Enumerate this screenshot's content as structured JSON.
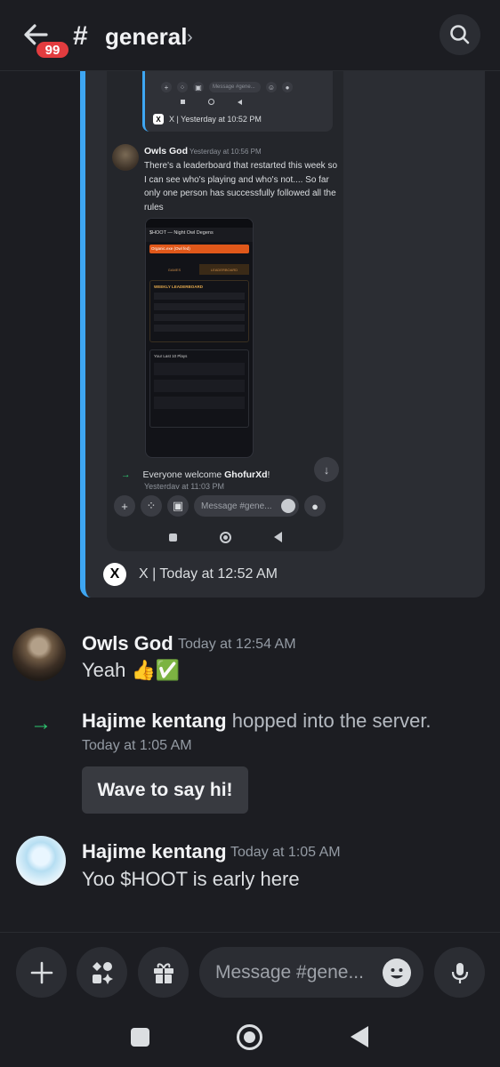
{
  "header": {
    "unread_count": "99",
    "hash": "#",
    "channel_name": "general",
    "chevron": "›"
  },
  "embed": {
    "phone": {
      "input_placeholder": "Message #gene...",
      "prev_embed_source": "X | Yesterday at 10:52 PM",
      "author": "Owls God",
      "time": "Yesterday at 10:56 PM",
      "text": "There's a leaderboard that restarted this week so I can see who's playing and who's not.... So far only one person has successfully followed all the rules",
      "shot": {
        "title": "$HOOT — Night Owl Degens",
        "banner": "Organic.exe (Owl fed)",
        "tab_left": "GAMES",
        "tab_right": "LEADERBOARD",
        "leaderboard_title": "WEEKLY LEADERBOARD",
        "plays_title": "Your Last 10 Plays"
      },
      "welcome_prefix": "Everyone welcome ",
      "welcome_name": "GhofurXd",
      "welcome_suffix": "!",
      "welcome_time": "Yesterday at 11:03 PM",
      "chat_input_placeholder": "Message #gene..."
    },
    "footer": "X | Today at 12:52 AM"
  },
  "messages": [
    {
      "author": "Owls God",
      "time": "Today at 12:54 AM",
      "text": "Yeah 👍✅"
    },
    {
      "author": "Hajime kentang",
      "time": "Today at 1:05 AM",
      "text": "Yoo $HOOT is early here"
    }
  ],
  "system": {
    "name": "Hajime kentang",
    "action": " hopped into the server.",
    "time": "Today at 1:05 AM",
    "wave_label": "Wave to say hi!"
  },
  "composer": {
    "placeholder": "Message #gene..."
  },
  "icons": {
    "back": "back-arrow-icon",
    "search": "search-icon",
    "plus": "plus-icon",
    "apps": "apps-icon",
    "gift": "gift-icon",
    "emoji": "emoji-icon",
    "mic": "microphone-icon"
  },
  "colors": {
    "background": "#1c1d22",
    "accent_blue": "#3ea6f2",
    "badge_red": "#e23c3f",
    "join_green": "#2dc770"
  }
}
